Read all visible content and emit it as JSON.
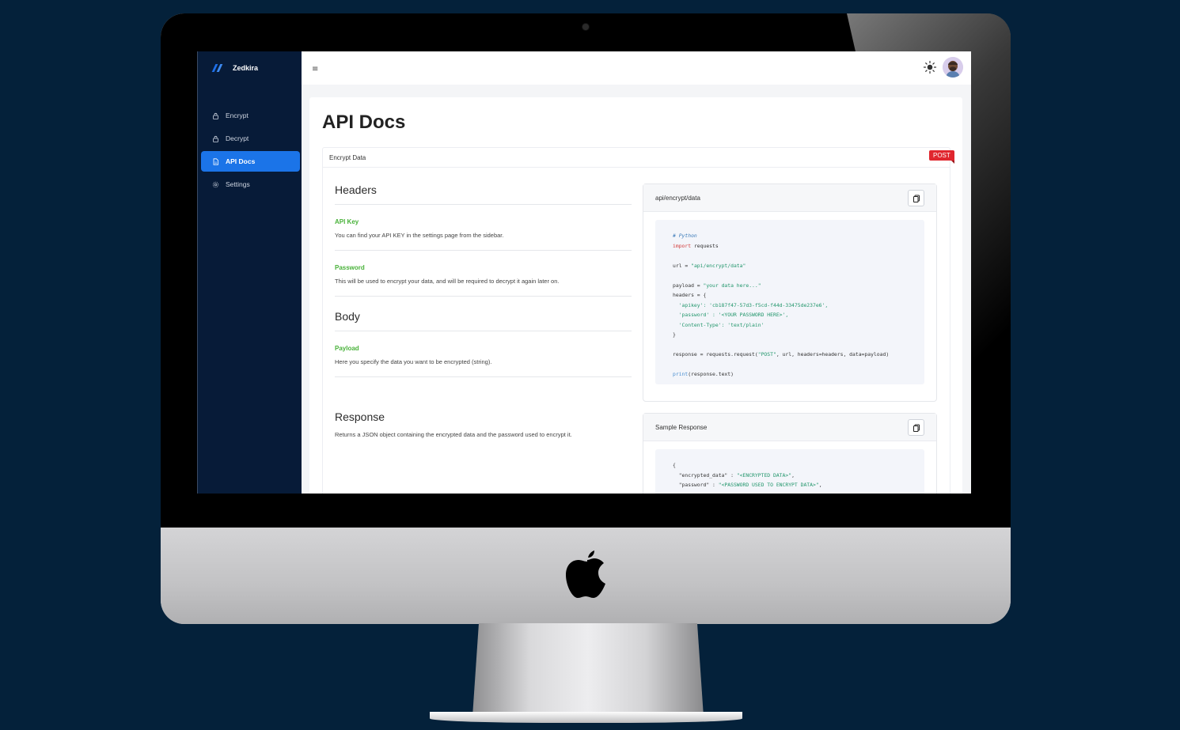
{
  "app": {
    "brand": "Zedkira"
  },
  "sidebar": {
    "items": [
      {
        "label": "Encrypt",
        "icon": "lock-icon",
        "active": false
      },
      {
        "label": "Decrypt",
        "icon": "lock-icon",
        "active": false
      },
      {
        "label": "API Docs",
        "icon": "document-icon",
        "active": true
      },
      {
        "label": "Settings",
        "icon": "gear-icon",
        "active": false
      }
    ]
  },
  "topbar": {
    "menu_icon": "hamburger-icon",
    "theme_icon": "sun-icon",
    "avatar_icon": "avatar"
  },
  "page": {
    "title": "API Docs"
  },
  "endpoint": {
    "name": "Encrypt Data",
    "method": "POST",
    "headers": {
      "title": "Headers",
      "fields": [
        {
          "name": "API Key",
          "desc": "You can find your API KEY in the settings page from the sidebar."
        },
        {
          "name": "Password",
          "desc": "This will be used to encrypt your data, and will be required to decrypt it again later on."
        }
      ]
    },
    "body": {
      "title": "Body",
      "fields": [
        {
          "name": "Payload",
          "desc": "Here you specify the data you want to be encrypted (string)."
        }
      ]
    },
    "response": {
      "title": "Response",
      "desc": "Returns a JSON object containing the encrypted data and the password used to encrypt it."
    },
    "request_example": {
      "title": "api/encrypt/data",
      "lines": [
        "# Python",
        "import requests",
        "",
        "url = \"api/encrypt/data\"",
        "",
        "payload = \"your data here...\"",
        "headers = {",
        "  'apikey': 'cb187f47-57d3-f5cd-f44d-33475de237e6',",
        "  'password' : '<YOUR PASSWORD HERE>',",
        "  'Content-Type': 'text/plain'",
        "}",
        "",
        "response = requests.request(\"POST\", url, headers=headers, data=payload)",
        "",
        "print(response.text)"
      ]
    },
    "sample_response": {
      "title": "Sample Response",
      "lines": [
        "{",
        "  \"encrypted_data\" : \"<ENCRYPTED DATA>\",",
        "  \"password\" : \"<PASSWORD USED TO ENCRYPT DATA>\","
      ]
    }
  },
  "colors": {
    "accent": "#1b74e8",
    "sidebar": "#071b38",
    "badge": "#e0262e",
    "field": "#49b23a"
  }
}
